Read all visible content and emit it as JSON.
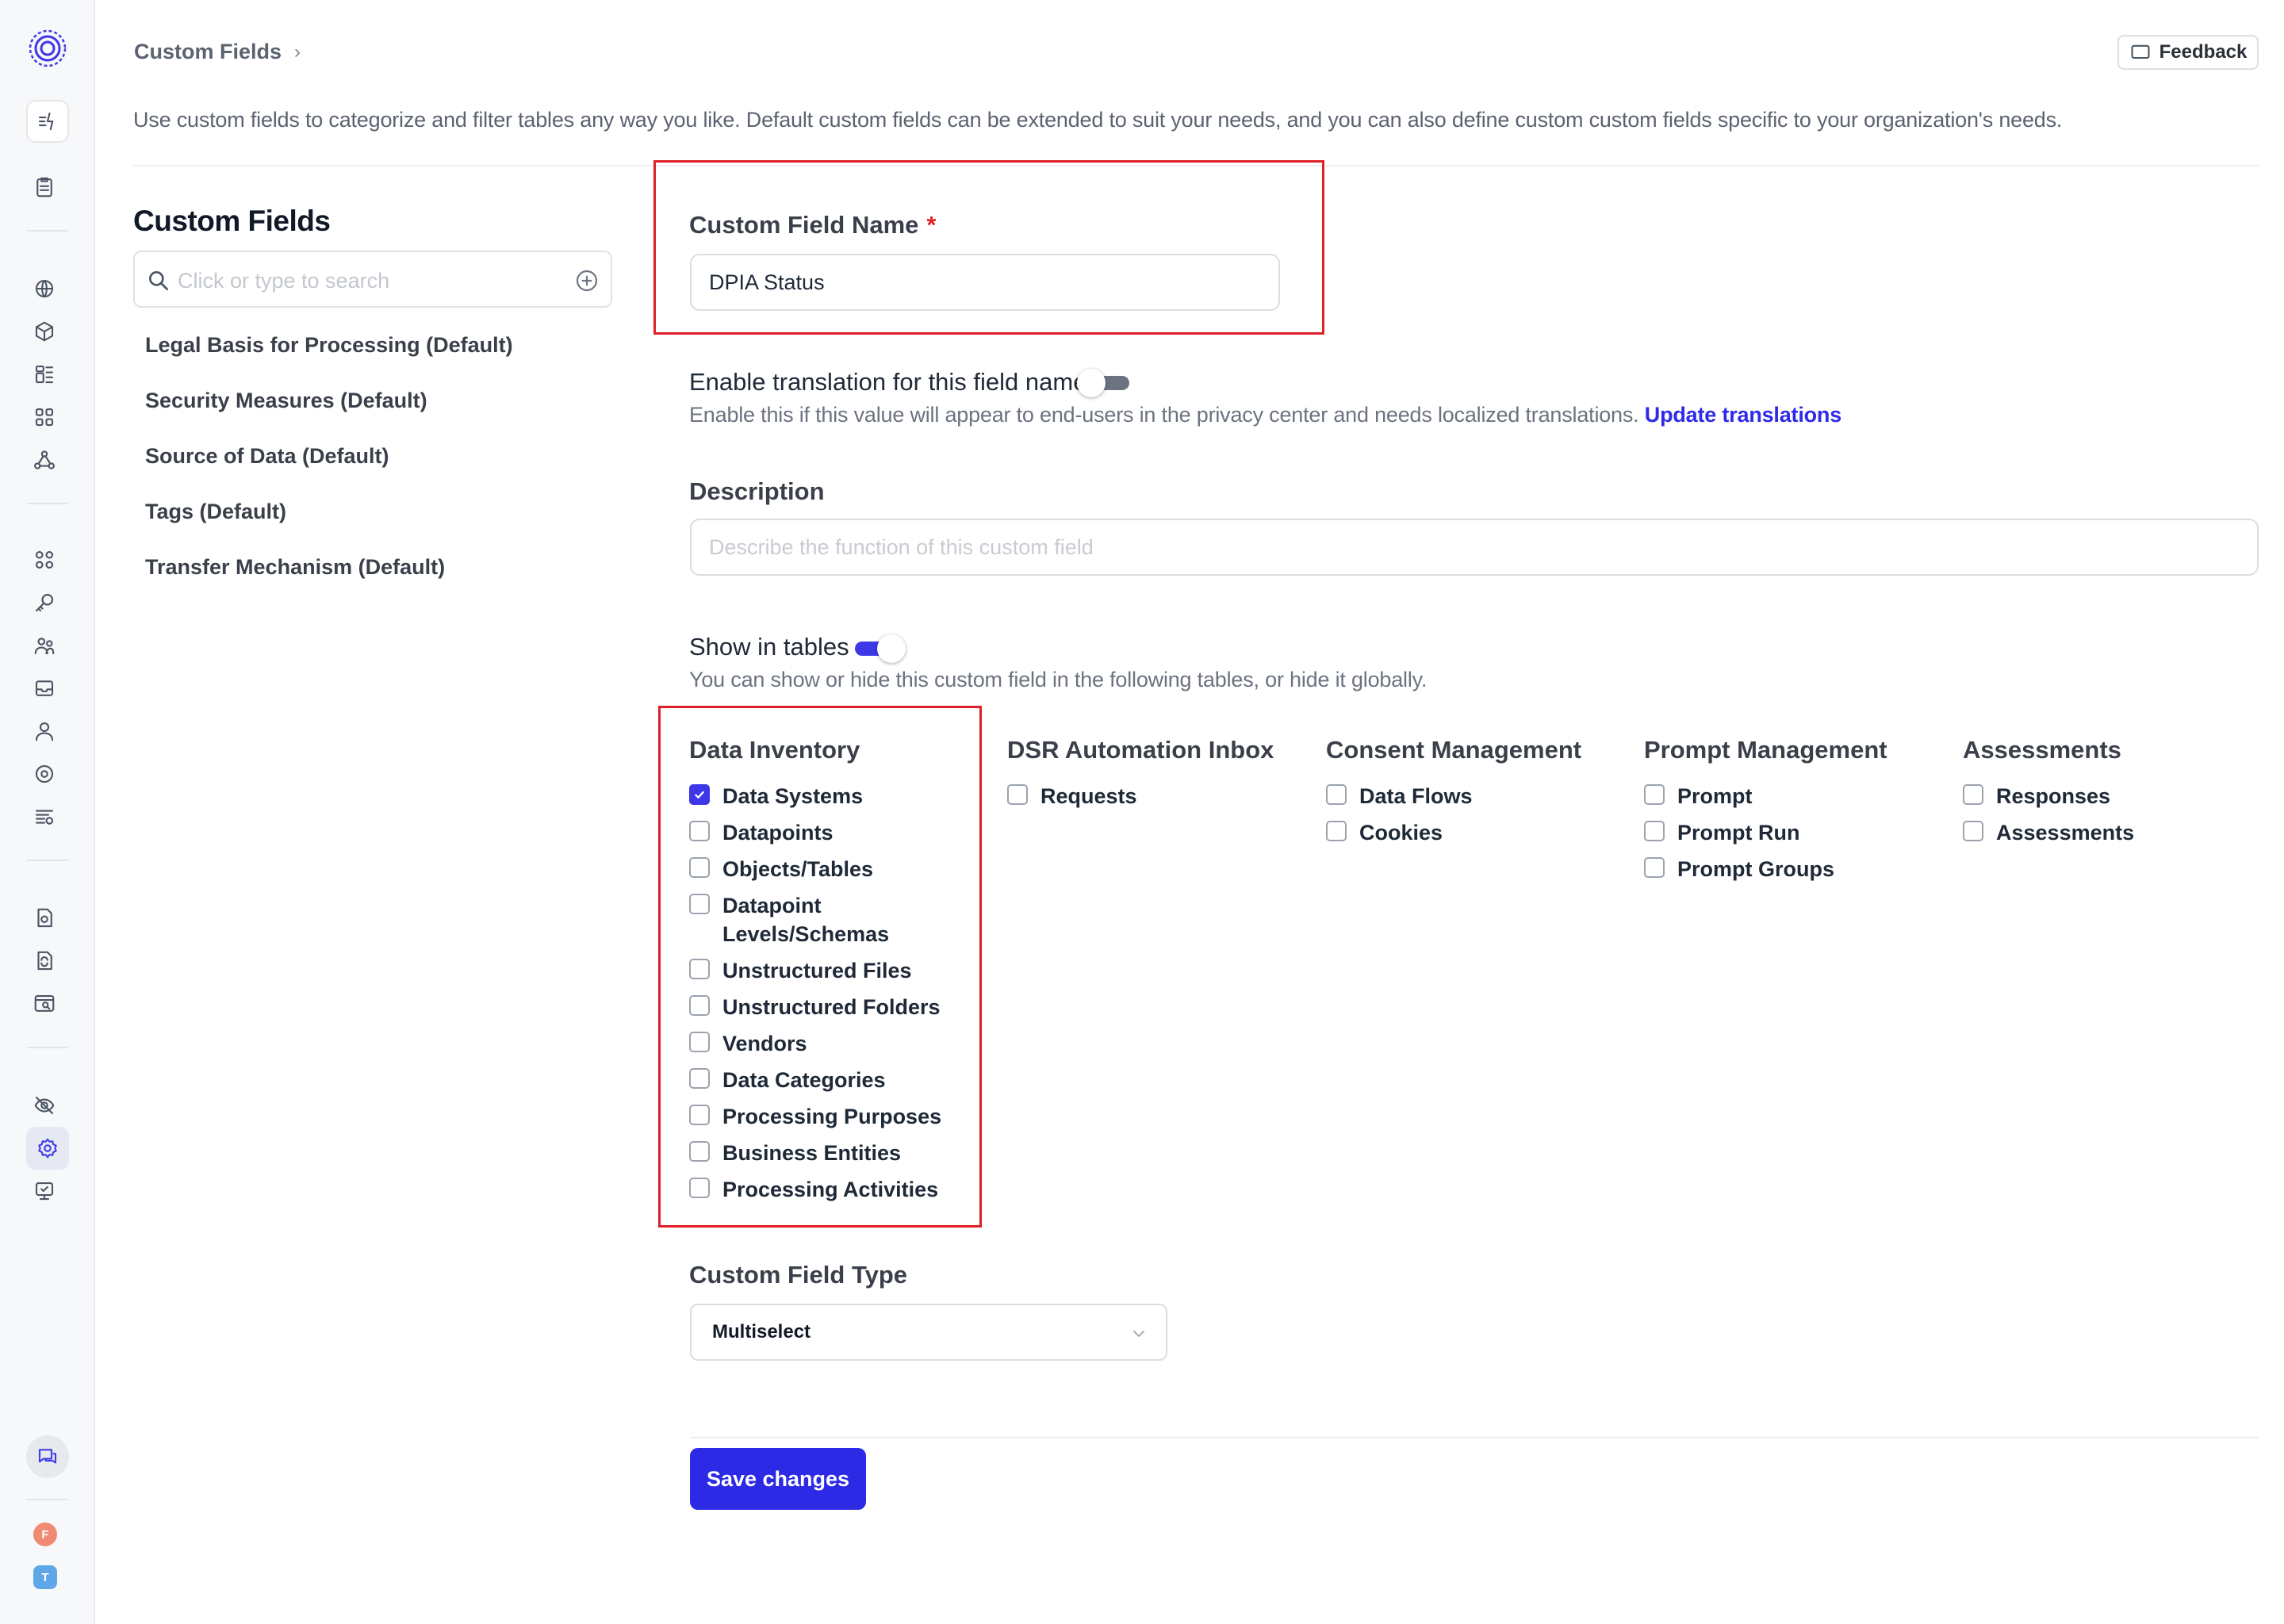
{
  "header": {
    "breadcrumb": "Custom Fields",
    "feedback_label": "Feedback",
    "intro": "Use custom fields to categorize and filter tables any way you like. Default custom fields can be extended to suit your needs, and you can also define custom custom fields specific to your organization's needs."
  },
  "list": {
    "title": "Custom Fields",
    "search_placeholder": "Click or type to search",
    "items": [
      "Legal Basis for Processing (Default)",
      "Security Measures (Default)",
      "Source of Data (Default)",
      "Tags (Default)",
      "Transfer Mechanism (Default)"
    ]
  },
  "form": {
    "name_label": "Custom Field Name",
    "name_required": "*",
    "name_value": "DPIA Status",
    "translation_label": "Enable translation for this field name",
    "translation_enabled": false,
    "translation_help": "Enable this if this value will appear to end-users in the privacy center and needs localized translations.",
    "translation_link": "Update translations",
    "description_label": "Description",
    "description_placeholder": "Describe the function of this custom field",
    "show_in_tables_label": "Show in tables",
    "show_in_tables_enabled": true,
    "show_in_tables_help": "You can show or hide this custom field in the following tables, or hide it globally.",
    "groups": [
      {
        "title": "Data Inventory",
        "options": [
          {
            "label": "Data Systems",
            "checked": true
          },
          {
            "label": "Datapoints",
            "checked": false
          },
          {
            "label": "Objects/Tables",
            "checked": false
          },
          {
            "label": "Datapoint Levels/Schemas",
            "checked": false
          },
          {
            "label": "Unstructured Files",
            "checked": false
          },
          {
            "label": "Unstructured Folders",
            "checked": false
          },
          {
            "label": "Vendors",
            "checked": false
          },
          {
            "label": "Data Categories",
            "checked": false
          },
          {
            "label": "Processing Purposes",
            "checked": false
          },
          {
            "label": "Business Entities",
            "checked": false
          },
          {
            "label": "Processing Activities",
            "checked": false
          }
        ]
      },
      {
        "title": "DSR Automation Inbox",
        "options": [
          {
            "label": "Requests",
            "checked": false
          }
        ]
      },
      {
        "title": "Consent Management",
        "options": [
          {
            "label": "Data Flows",
            "checked": false
          },
          {
            "label": "Cookies",
            "checked": false
          }
        ]
      },
      {
        "title": "Prompt Management",
        "options": [
          {
            "label": "Prompt",
            "checked": false
          },
          {
            "label": "Prompt Run",
            "checked": false
          },
          {
            "label": "Prompt Groups",
            "checked": false
          }
        ]
      },
      {
        "title": "Assessments",
        "options": [
          {
            "label": "Responses",
            "checked": false
          },
          {
            "label": "Assessments",
            "checked": false
          }
        ]
      }
    ],
    "type_label": "Custom Field Type",
    "type_value": "Multiselect",
    "save_label": "Save changes"
  },
  "user": {
    "avatar_f": "F",
    "avatar_t": "T"
  },
  "colors": {
    "accent": "#2d2ae6",
    "highlight": "#e01f26"
  }
}
